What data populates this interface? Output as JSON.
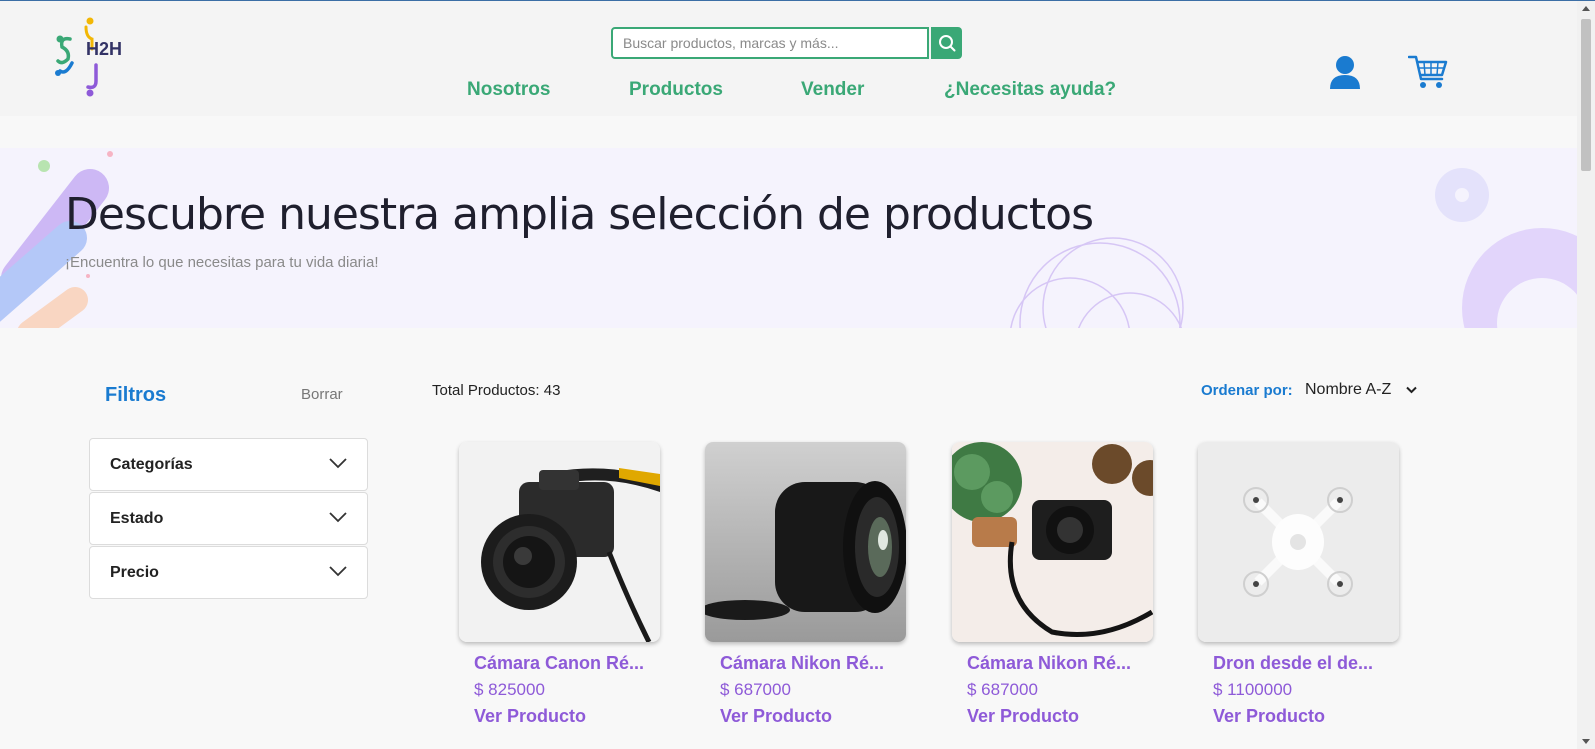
{
  "header": {
    "logo_text": "H2H",
    "search_placeholder": "Buscar productos, marcas y más...",
    "nav": [
      {
        "label": "Nosotros"
      },
      {
        "label": "Productos"
      },
      {
        "label": "Vender"
      },
      {
        "label": "¿Necesitas ayuda?"
      }
    ],
    "icons": [
      "search-icon",
      "user-icon",
      "cart-icon"
    ]
  },
  "hero": {
    "title": "Descubre nuestra amplia selección de productos",
    "subtitle": "¡Encuentra lo que necesitas para tu vida diaria!"
  },
  "filters": {
    "title": "Filtros",
    "clear_label": "Borrar",
    "items": [
      {
        "label": "Categorías"
      },
      {
        "label": "Estado"
      },
      {
        "label": "Precio"
      }
    ]
  },
  "products": {
    "total_label": "Total Productos: 43",
    "sort_label": "Ordenar por:",
    "sort_value": "Nombre A-Z",
    "view_label": "Ver Producto",
    "items": [
      {
        "name": "Cámara Canon Ré...",
        "price": "$ 825000",
        "image": "camera-photo"
      },
      {
        "name": "Cámara Nikon Ré...",
        "price": "$ 687000",
        "image": "lens-photo"
      },
      {
        "name": "Cámara Nikon Ré...",
        "price": "$ 687000",
        "image": "camera-plant-photo"
      },
      {
        "name": "Dron desde el de...",
        "price": "$ 1100000",
        "image": "drone-photo"
      }
    ]
  },
  "colors": {
    "accent_green": "#3aa876",
    "accent_blue": "#1a7bd0",
    "product_purple": "#8e5ad8",
    "hero_bg": "#f5f3fd"
  }
}
